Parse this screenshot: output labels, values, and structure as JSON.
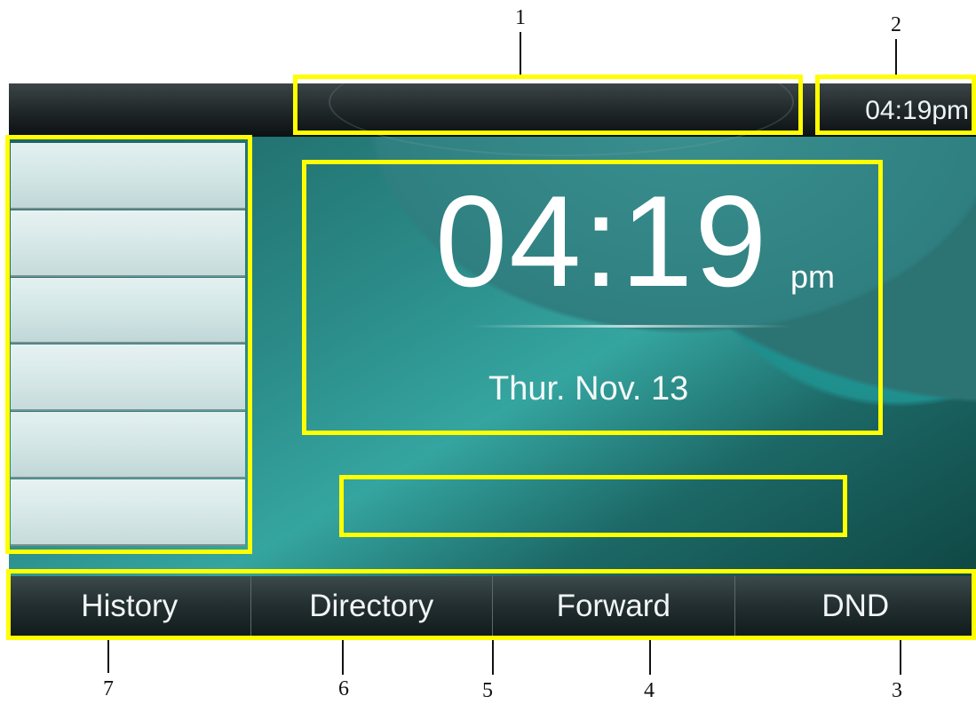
{
  "callouts": [
    "1",
    "2",
    "3",
    "4",
    "5",
    "6",
    "7"
  ],
  "status_bar": {
    "clock": "04:19pm"
  },
  "clock": {
    "time": "04:19",
    "ampm": "pm",
    "date": "Thur. Nov. 13"
  },
  "softkeys": [
    "History",
    "Directory",
    "Forward",
    "DND"
  ],
  "line_keys_count": 6,
  "colors": {
    "highlight": "#ffff00",
    "screen_teal": "#2b8b88"
  }
}
